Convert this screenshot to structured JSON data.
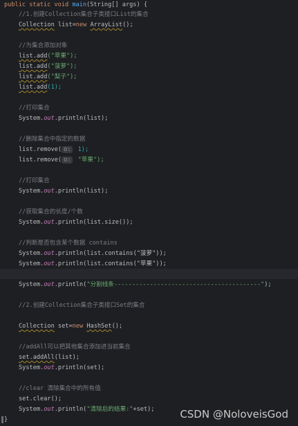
{
  "code": {
    "method_keywords": "public static void",
    "method_name": "main",
    "method_params": "(String[] args) {",
    "c1": "//1.创建Collection集合子类接口List的集合",
    "l_list_decl_type": "Collection",
    "l_list_decl_rest": " list=",
    "l_new": "new",
    "l_arraylist": "ArrayList",
    "l_paren_semi": "();",
    "c2": "//为集合添加对象",
    "add_prefix": "list.add",
    "add1_arg": "(\"苹果\");",
    "add2_arg": "(\"菠萝\");",
    "add3_arg": "(\"梨子\");",
    "add4_arg": "(1);",
    "c3": "//打印集合",
    "sys_prefix": "System.",
    "out_field": "out",
    "println_list": ".println(list);",
    "c4": "//删除集合中指定的数据",
    "remove_prefix": "list.remove(",
    "hint_o": "o:",
    "remove1_arg": " 1);",
    "remove2_arg": " \"苹果\");",
    "c5": "//打印集合",
    "c6": "//获取集合的长度/个数",
    "println_size": ".println(list.size());",
    "c7": "//判断是否包含某个数据 contains",
    "println_contains1": ".println(list.contains(\"菠萝\"));",
    "println_contains2": ".println(list.contains(\"苹果\"));",
    "println_sep_open": ".println(",
    "sep_str": "\"分割线条-----------------------------------------\"",
    "sep_close": ");",
    "c8": "//2.创建Collection集合子类接口Set的集合",
    "s_type": "Collection",
    "s_rest": " set=",
    "s_new": "new",
    "s_hashset": "HashSet",
    "c9": "//addAll可以把其他集合添加进当前集合",
    "addall_call": "set.addAll",
    "addall_arg": "(list);",
    "println_set": ".println(set);",
    "c10": "//clear 清除集合中的所有值",
    "clear_call": "set.clear();",
    "println_final_open": ".println(",
    "final_str": "\"清除后的结果:\"",
    "final_close": "+set);",
    "closing_brace": "}"
  },
  "watermark": "CSDN @NoloveisGod"
}
